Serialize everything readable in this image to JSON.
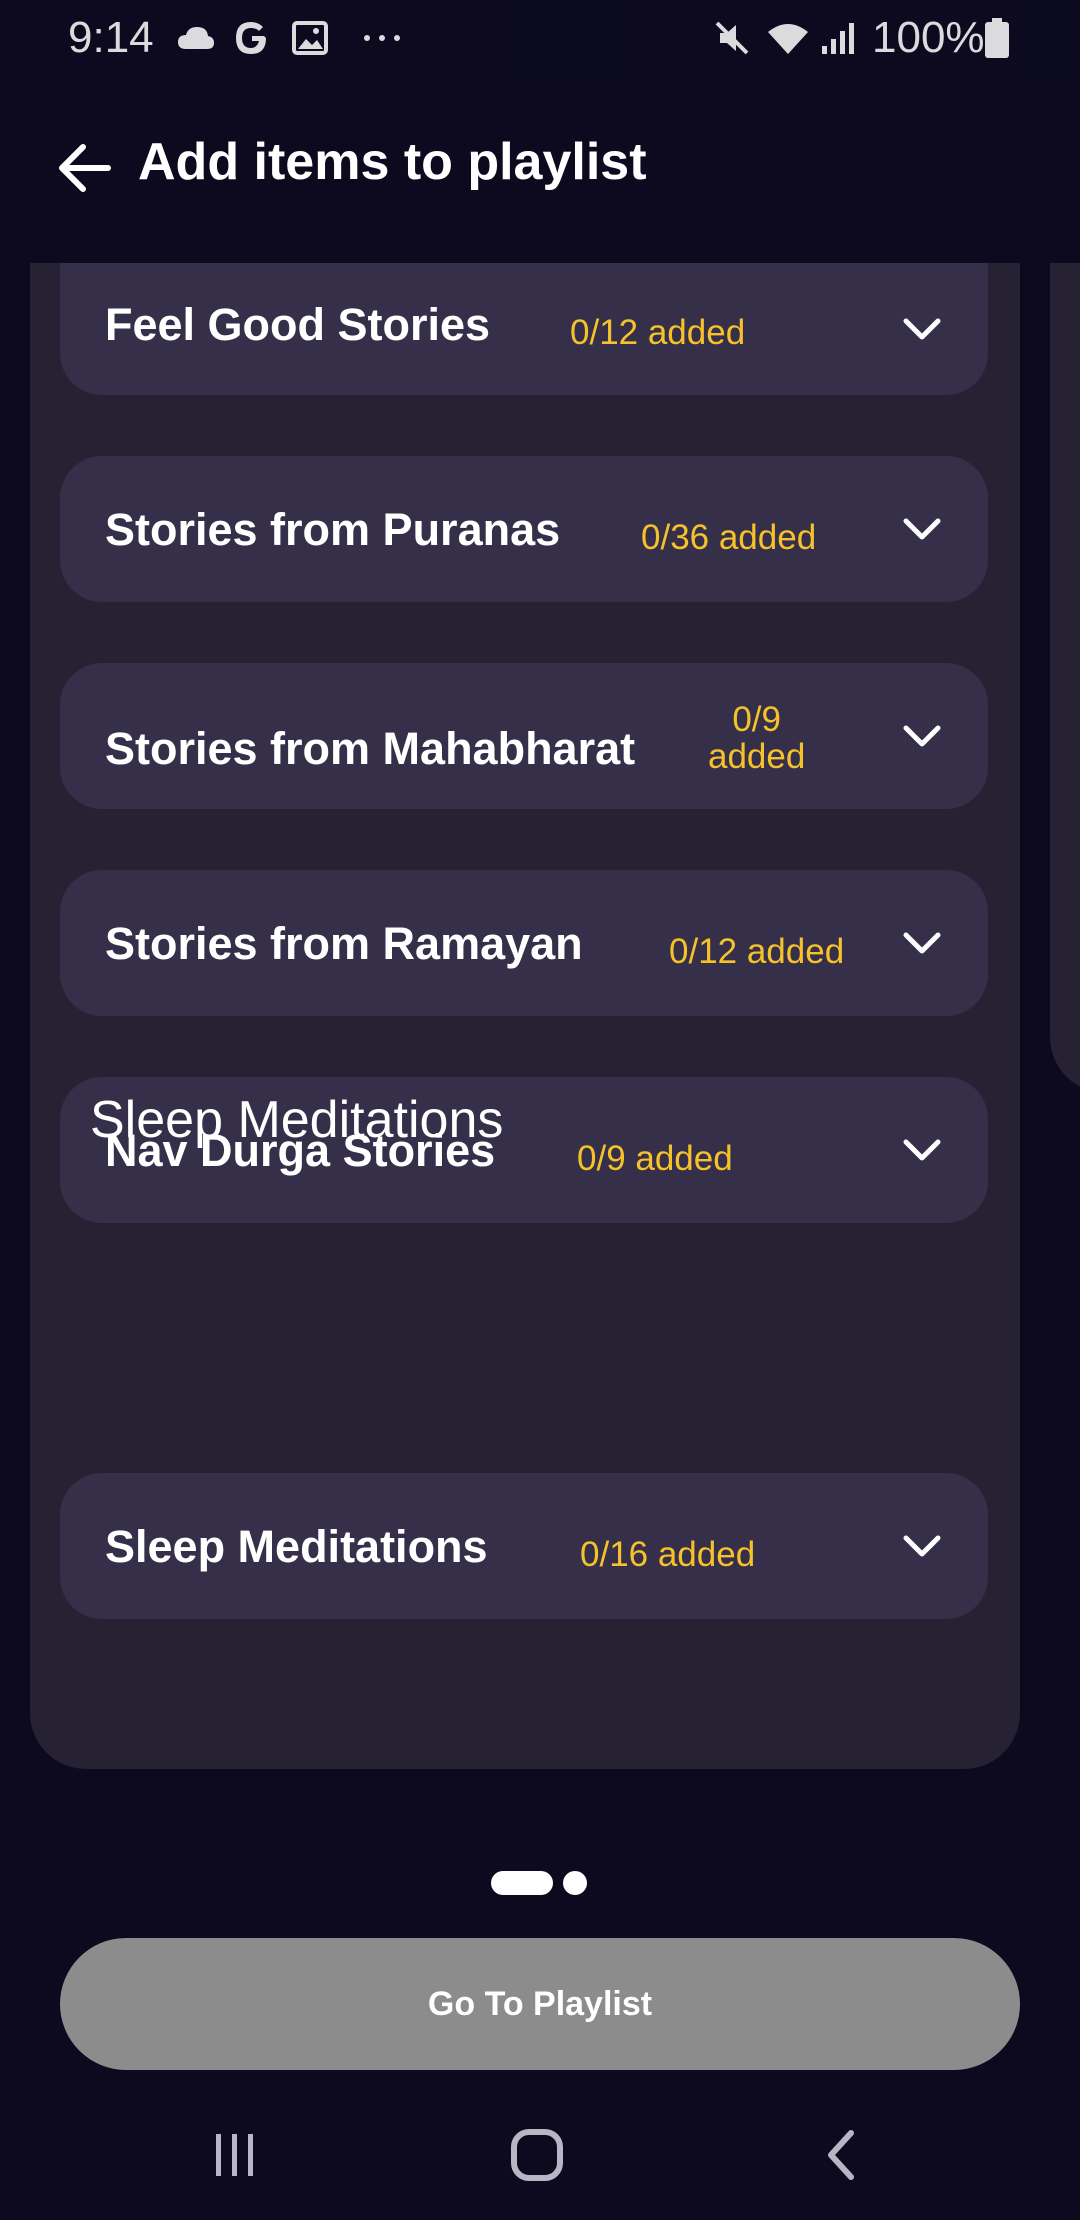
{
  "status_bar": {
    "time": "9:14",
    "battery": "100%",
    "icons": [
      "cloud-icon",
      "google-icon",
      "image-icon",
      "more-icon",
      "mute-icon",
      "wifi-icon",
      "signal-icon",
      "battery-icon"
    ]
  },
  "header": {
    "title": "Add items to playlist",
    "back_icon": "arrow-left-icon"
  },
  "collections": [
    {
      "title": "Feel Good Stories",
      "count": "0/12 added"
    },
    {
      "title": "Stories from Puranas",
      "count": "0/36 added"
    },
    {
      "title": "Stories from Mahabharat",
      "count_line1": "0/9",
      "count_line2": "added"
    },
    {
      "title": "Stories from Ramayan",
      "count": "0/12 added"
    },
    {
      "title": "Nav Durga Stories",
      "count": "0/9 added"
    }
  ],
  "section": {
    "heading": "Sleep Meditations",
    "items": [
      {
        "title": "Sleep Meditations",
        "count": "0/16 added"
      }
    ]
  },
  "pager": {
    "pages": 2,
    "active": 1
  },
  "primary_button": {
    "label": "Go To Playlist"
  },
  "colors": {
    "background": "#0d0a1f",
    "panel": "#272233",
    "card": "#362f4a",
    "accent": "#f6c22a",
    "button_disabled": "#8c8c8c"
  }
}
